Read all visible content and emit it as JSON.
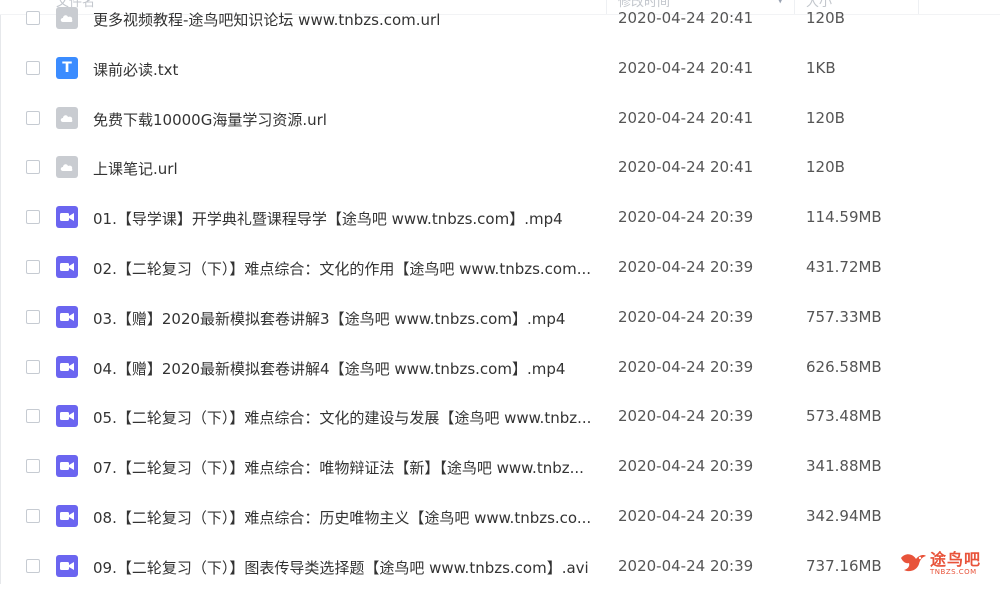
{
  "header": {
    "col_name": "文件名",
    "col_modified": "修改时间",
    "col_size": "大小"
  },
  "files": [
    {
      "name": "更多视频教程-途鸟吧知识论坛 www.tnbzs.com.url",
      "modified": "2020-04-24 20:41",
      "size": "120B",
      "type": "url",
      "icon": "link-file-icon"
    },
    {
      "name": "课前必读.txt",
      "modified": "2020-04-24 20:41",
      "size": "1KB",
      "type": "txt",
      "icon": "text-file-icon",
      "icon_letter": "T"
    },
    {
      "name": "免费下载10000G海量学习资源.url",
      "modified": "2020-04-24 20:41",
      "size": "120B",
      "type": "url",
      "icon": "link-file-icon"
    },
    {
      "name": "上课笔记.url",
      "modified": "2020-04-24 20:41",
      "size": "120B",
      "type": "url",
      "icon": "link-file-icon"
    },
    {
      "name": "01.【导学课】开学典礼暨课程导学【途鸟吧 www.tnbzs.com】.mp4",
      "modified": "2020-04-24 20:39",
      "size": "114.59MB",
      "type": "video",
      "icon": "video-file-icon"
    },
    {
      "name": "02.【二轮复习（下）】难点综合：文化的作用【途鸟吧 www.tnbzs.com...",
      "modified": "2020-04-24 20:39",
      "size": "431.72MB",
      "type": "video",
      "icon": "video-file-icon"
    },
    {
      "name": "03.【赠】2020最新模拟套卷讲解3【途鸟吧 www.tnbzs.com】.mp4",
      "modified": "2020-04-24 20:39",
      "size": "757.33MB",
      "type": "video",
      "icon": "video-file-icon"
    },
    {
      "name": "04.【赠】2020最新模拟套卷讲解4【途鸟吧 www.tnbzs.com】.mp4",
      "modified": "2020-04-24 20:39",
      "size": "626.58MB",
      "type": "video",
      "icon": "video-file-icon"
    },
    {
      "name": "05.【二轮复习（下）】难点综合：文化的建设与发展【途鸟吧 www.tnbz...",
      "modified": "2020-04-24 20:39",
      "size": "573.48MB",
      "type": "video",
      "icon": "video-file-icon"
    },
    {
      "name": "07.【二轮复习（下）】难点综合：唯物辩证法【新】【途鸟吧 www.tnbz...",
      "modified": "2020-04-24 20:39",
      "size": "341.88MB",
      "type": "video",
      "icon": "video-file-icon"
    },
    {
      "name": "08.【二轮复习（下）】难点综合：历史唯物主义【途鸟吧 www.tnbzs.co...",
      "modified": "2020-04-24 20:39",
      "size": "342.94MB",
      "type": "video",
      "icon": "video-file-icon"
    },
    {
      "name": "09.【二轮复习（下）】图表传导类选择题【途鸟吧 www.tnbzs.com】.avi",
      "modified": "2020-04-24 20:39",
      "size": "737.16MB",
      "type": "video",
      "icon": "video-file-icon"
    }
  ],
  "watermark": {
    "text": "途鸟吧",
    "sub": "TNBZS.COM"
  },
  "colors": {
    "txt_icon": "#3b8cff",
    "url_icon": "#c9ccd1",
    "video_icon": "#6b65f0",
    "watermark": "#e8533a"
  }
}
